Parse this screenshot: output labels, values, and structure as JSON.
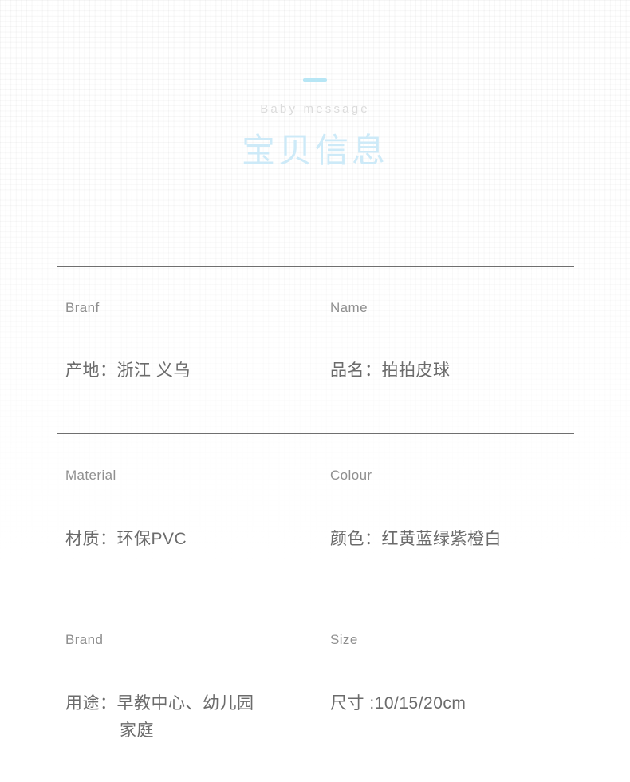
{
  "header": {
    "accent_bar": "accent-bar",
    "subtitle": "Baby  message",
    "title": "宝贝信息",
    "accent_color": "#b7e6f5",
    "title_color": "#cdeaf8",
    "subtitle_color": "#dcdcdc"
  },
  "info": {
    "divider_color": "#6f6f6f",
    "rows": [
      {
        "left": {
          "label": "Branf",
          "value": "产地：浙江 义乌",
          "value_cont": ""
        },
        "right": {
          "label": "Name",
          "value": "品名：拍拍皮球",
          "value_cont": ""
        }
      },
      {
        "left": {
          "label": "Material",
          "value": "材质：环保PVC",
          "value_cont": ""
        },
        "right": {
          "label": "Colour",
          "value": "颜色：红黄蓝绿紫橙白",
          "value_cont": ""
        }
      },
      {
        "left": {
          "label": "Brand",
          "value": "用途：早教中心、幼儿园",
          "value_cont": "家庭"
        },
        "right": {
          "label": "Size",
          "value": "尺寸 :10/15/20cm",
          "value_cont": ""
        }
      }
    ]
  }
}
